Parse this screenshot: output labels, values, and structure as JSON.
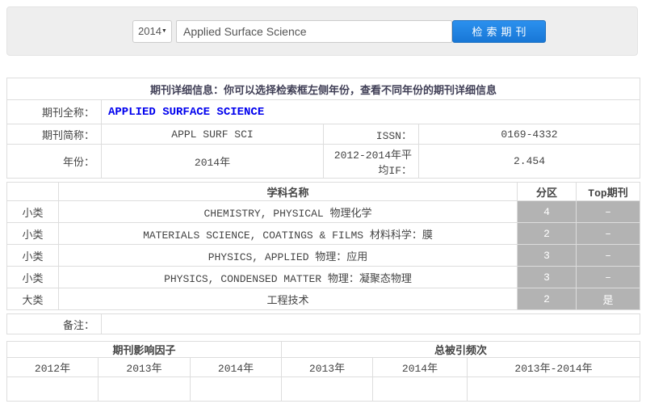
{
  "search": {
    "year_selected": "2014",
    "query": "Applied Surface Science",
    "button_label": "检索期刊"
  },
  "caption": "期刊详细信息：你可以选择检索框左侧年份，查看不同年份的期刊详细信息",
  "journal": {
    "full_name_label": "期刊全称：",
    "full_name": "APPLIED SURFACE SCIENCE",
    "short_name_label": "期刊简称：",
    "short_name": "APPL SURF SCI",
    "issn_label": "ISSN：",
    "issn": "0169-4332",
    "year_label": "年份：",
    "year": "2014年",
    "avg_if_label": "2012-2014年平均IF：",
    "avg_if": "2.454"
  },
  "subjects": {
    "headers": {
      "name": "学科名称",
      "partition": "分区",
      "top": "Top期刊"
    },
    "rows": [
      {
        "type": "小类",
        "name": "CHEMISTRY, PHYSICAL 物理化学",
        "partition": "4",
        "top": "–"
      },
      {
        "type": "小类",
        "name": "MATERIALS SCIENCE, COATINGS & FILMS 材料科学：膜",
        "partition": "2",
        "top": "–"
      },
      {
        "type": "小类",
        "name": "PHYSICS, APPLIED 物理：应用",
        "partition": "3",
        "top": "–"
      },
      {
        "type": "小类",
        "name": "PHYSICS, CONDENSED MATTER 物理：凝聚态物理",
        "partition": "3",
        "top": "–"
      },
      {
        "type": "大类",
        "name": "工程技术",
        "partition": "2",
        "top": "是"
      }
    ]
  },
  "remark": {
    "label": "备注：",
    "value": ""
  },
  "metrics": {
    "groups": [
      {
        "label": "期刊影响因子"
      },
      {
        "label": "总被引频次"
      }
    ],
    "year_headers": [
      "2012年",
      "2013年",
      "2014年",
      "2013年",
      "2014年",
      "2013年-2014年"
    ]
  },
  "icons": {
    "caret_down": "▼"
  },
  "colors": {
    "button_blue": "#1e86e6",
    "link_blue": "#0000ee",
    "partition_cell_gray": "#b3b3b3",
    "well_gray": "#eeeeee",
    "table_border": "#dddddd"
  }
}
